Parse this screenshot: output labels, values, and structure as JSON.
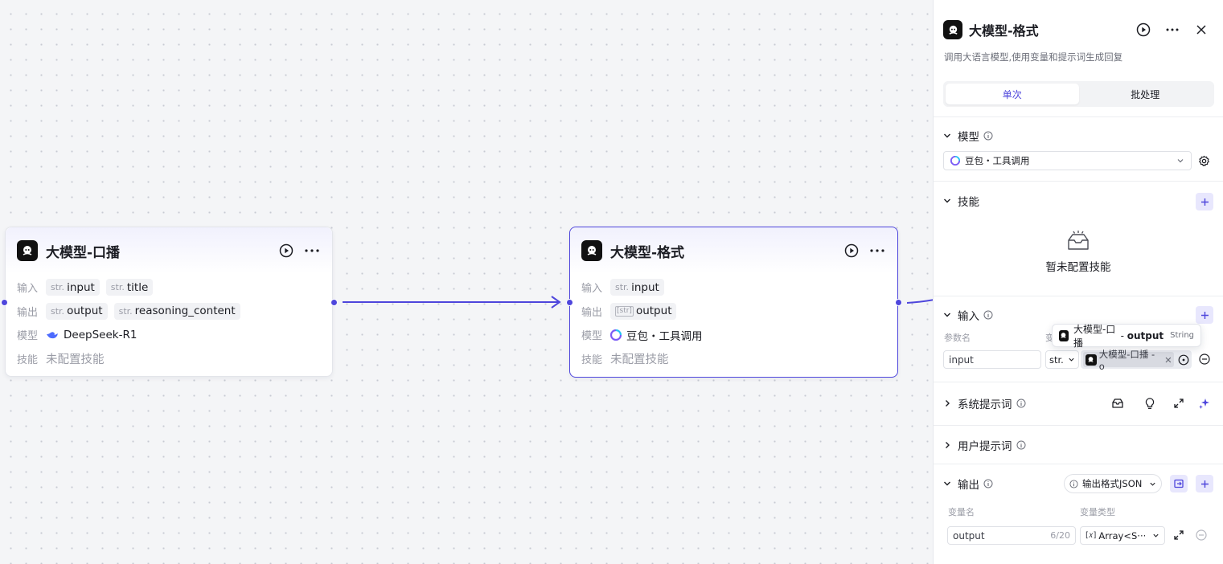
{
  "canvas": {
    "node_broadcast": {
      "title": "大模型-口播",
      "input_label": "输入",
      "inputs": [
        {
          "type": "str.",
          "name": "input"
        },
        {
          "type": "str.",
          "name": "title"
        }
      ],
      "output_label": "输出",
      "outputs": [
        {
          "type": "str.",
          "name": "output"
        },
        {
          "type": "str.",
          "name": "reasoning_content"
        }
      ],
      "model_label": "模型",
      "model_name": "DeepSeek-R1",
      "skill_label": "技能",
      "skill_value": "未配置技能"
    },
    "node_format": {
      "title": "大模型-格式",
      "input_label": "输入",
      "inputs": [
        {
          "type": "str.",
          "name": "input"
        }
      ],
      "output_label": "输出",
      "outputs": [
        {
          "type": "[str]",
          "name": "output"
        }
      ],
      "model_label": "模型",
      "model_name": "豆包・工具调用",
      "skill_label": "技能",
      "skill_value": "未配置技能"
    }
  },
  "panel": {
    "title": "大模型-格式",
    "description": "调用大语言模型,使用变量和提示词生成回复",
    "tabs": [
      {
        "label": "单次",
        "active": true
      },
      {
        "label": "批处理",
        "active": false
      }
    ],
    "model_section": {
      "title": "模型",
      "selected": "豆包・工具调用"
    },
    "skills_section": {
      "title": "技能",
      "empty_text": "暂未配置技能"
    },
    "input_section": {
      "title": "输入",
      "col_param": "参数名",
      "col_value_partial": "变",
      "param_value": "input",
      "type_value": "str.",
      "ref_chip": "大模型-口播 - o"
    },
    "tooltip": {
      "node": "大模型-口播",
      "sep": " - ",
      "var": "output",
      "type": "String"
    },
    "system_prompt": {
      "title": "系统提示词"
    },
    "user_prompt": {
      "title": "用户提示词"
    },
    "output_section": {
      "title": "输出",
      "format_select": "输出格式JSON",
      "col_name": "变量名",
      "col_type": "变量类型",
      "var_name": "output",
      "var_count": "6/20",
      "var_type": "Array<S···"
    }
  },
  "colors": {
    "accent": "#4e46dc",
    "accent_soft": "#e8e7fd",
    "muted": "#9a9ca6"
  }
}
